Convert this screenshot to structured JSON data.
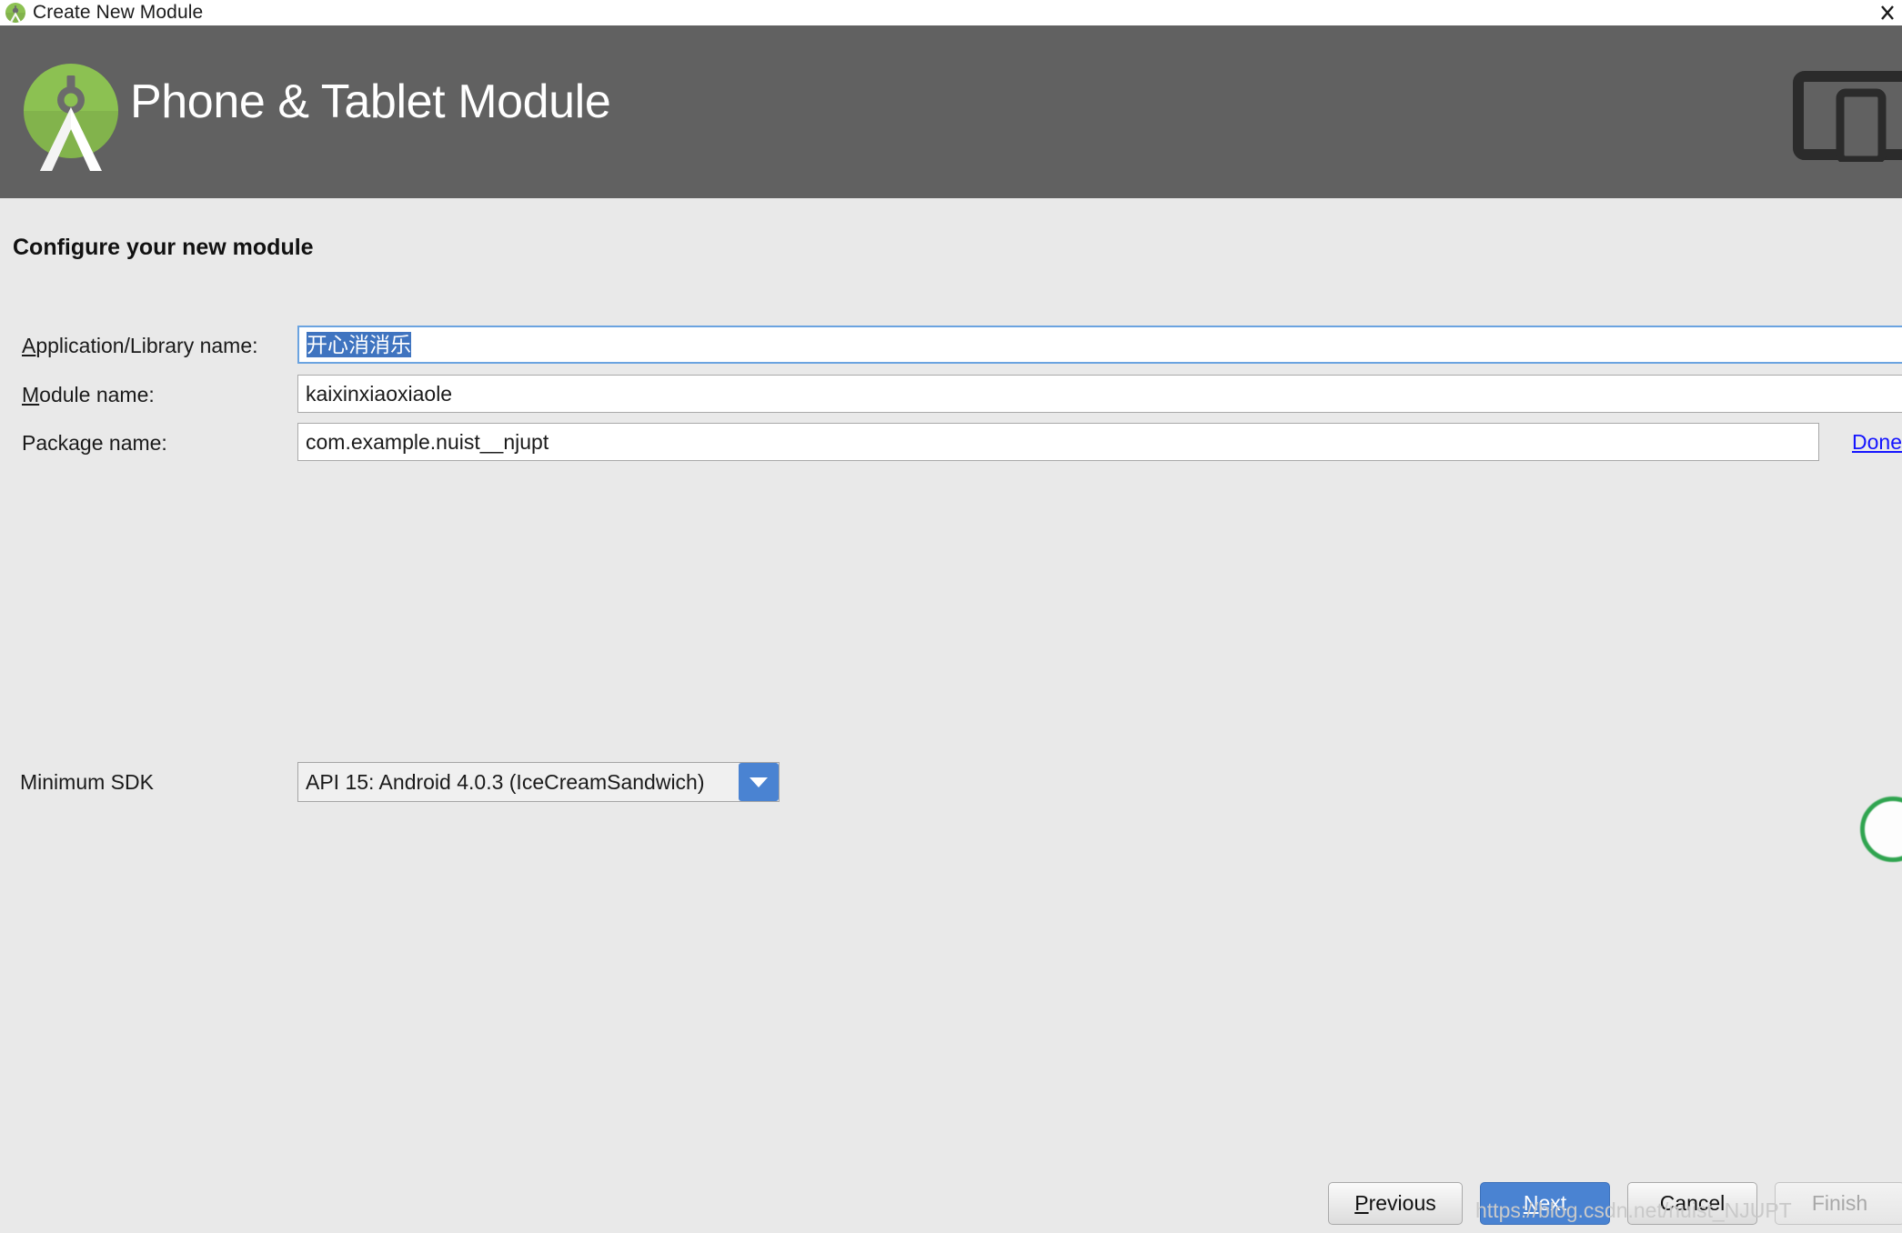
{
  "window": {
    "title": "Create New Module",
    "app_icon": "android-studio-logo-icon",
    "close_icon": "close-icon"
  },
  "header": {
    "title": "Phone & Tablet Module",
    "logo_icon": "android-studio-logo-icon",
    "device_icon": "phone-tablet-icon",
    "background_color": "#616161"
  },
  "body": {
    "section_title": "Configure your new module",
    "background_color": "#e9e9e9"
  },
  "form": {
    "fields": [
      {
        "label_prefix": "A",
        "label_rest": "pplication/Library name:",
        "value": "开心消消乐",
        "focused": true,
        "selected": true
      },
      {
        "label_prefix": "M",
        "label_rest": "odule name:",
        "value": "kaixinxiaoxiaole",
        "focused": false,
        "selected": false
      },
      {
        "label_prefix": "",
        "label_rest": "Package name:",
        "value": "com.example.nuist__njupt",
        "focused": false,
        "selected": false
      }
    ],
    "done_link": "Done",
    "sdk_label": "Minimum SDK",
    "sdk_value": "API 15: Android 4.0.3 (IceCreamSandwich)",
    "sdk_arrow_icon": "chevron-down-icon",
    "accent_color": "#4a83d2",
    "selection_color": "#3f74c0",
    "link_color": "#1414ff"
  },
  "footer": {
    "previous": {
      "prefix": "P",
      "rest": "revious"
    },
    "next": {
      "prefix": "N",
      "rest": "ext"
    },
    "cancel": {
      "prefix": "",
      "rest": "Cancel"
    },
    "finish": {
      "prefix": "",
      "rest": "Finish"
    }
  },
  "watermark": "https://blog.csdn.net/nuist_NJUPT"
}
